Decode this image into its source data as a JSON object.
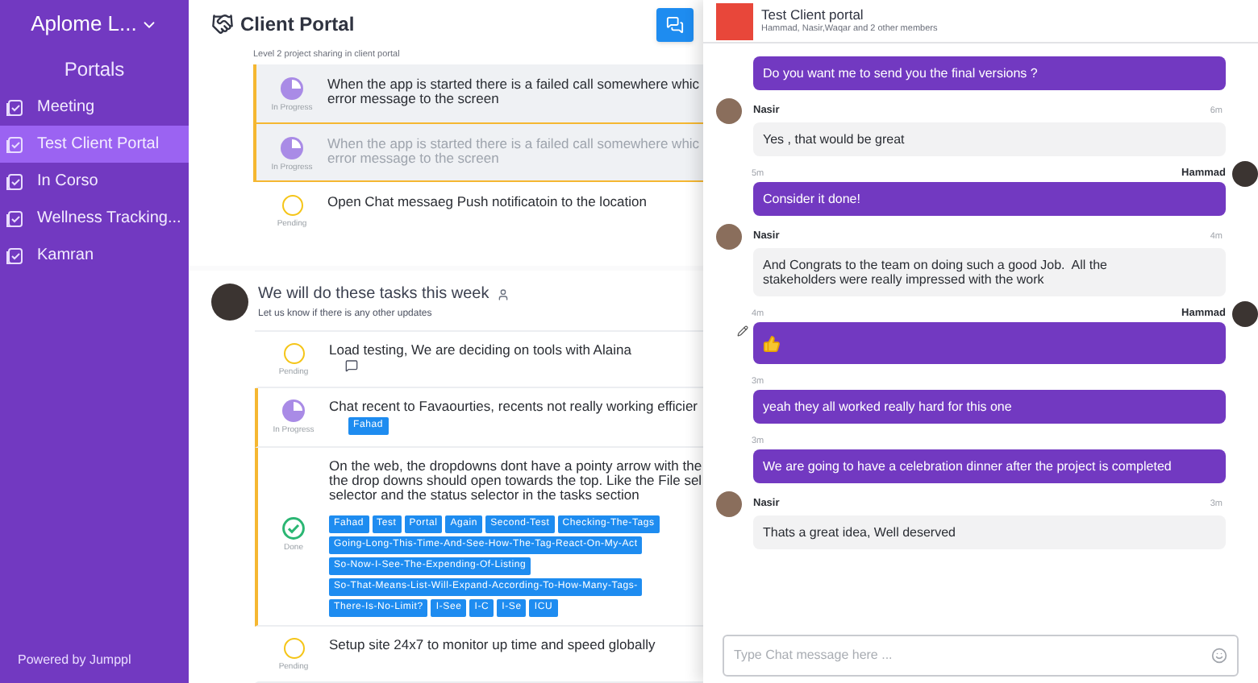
{
  "sidebar": {
    "org": "Aplome L...",
    "section": "Portals",
    "items": [
      {
        "label": "Meeting",
        "selected": false
      },
      {
        "label": "Test Client Portal",
        "selected": true
      },
      {
        "label": "In Corso",
        "selected": false
      },
      {
        "label": "Wellness Tracking...",
        "selected": false
      },
      {
        "label": "Kamran",
        "selected": false
      }
    ],
    "footer": "Powered by Jumppl"
  },
  "header": {
    "title": "Client Portal"
  },
  "main": {
    "note": "Level 2 project sharing in client portal",
    "tasks": [
      {
        "kind": "in_progress",
        "status_label": "In Progress",
        "text": "When the app is started there is a failed call somewhere whic\nerror message to the screen",
        "ghost": false,
        "selected": true
      },
      {
        "kind": "in_progress",
        "status_label": "In Progress",
        "text": "When the app is started there is a failed call somewhere whic\nerror message to the screen",
        "ghost": true,
        "selected": true
      },
      {
        "kind": "pending",
        "status_label": "Pending",
        "text": "Open Chat messaeg Push notificatoin to the location",
        "ghost": false,
        "selected": false
      }
    ],
    "post": {
      "title": "We will do these tasks this week",
      "subtitle": "Let us know if there is any other updates",
      "tasks": [
        {
          "kind": "pending",
          "status_label": "Pending",
          "text": "Load testing, We are deciding on tools with Alaina",
          "comment": true
        },
        {
          "kind": "in_progress",
          "status_label": "In Progress",
          "text": "Chat recent to Favaourties, recents not really working efficier",
          "comment": false,
          "tag_rows": [
            [
              "Fahad"
            ]
          ]
        },
        {
          "kind": "done",
          "status_label": "Done",
          "text": "On the web, the dropdowns dont have a pointy arrow with the\nthe drop downs should open towards the top. Like the File sel\nselector and the status selector in the tasks section",
          "comment": false,
          "tag_rows": [
            [
              "Fahad",
              "Test",
              "Portal",
              "Again",
              "Second-Test",
              "Checking-The-Tags"
            ],
            [
              "Going-Long-This-Time-And-See-How-The-Tag-React-On-My-Act"
            ],
            [
              "So-Now-I-See-The-Expending-Of-Listing"
            ],
            [
              "So-That-Means-List-Will-Expand-According-To-How-Many-Tags-"
            ],
            [
              "There-Is-No-Limit?",
              "I-See",
              "I-C",
              "I-Se",
              "ICU"
            ]
          ]
        },
        {
          "kind": "pending",
          "status_label": "Pending",
          "text": "Setup site 24x7 to monitor up time and speed globally",
          "comment": false
        }
      ]
    }
  },
  "chat": {
    "title": "Test Client portal",
    "members": "Hammad, Nasir,Waqar and 2 other members",
    "messages": [
      {
        "kind": "text",
        "outgoing": true,
        "text": "Do you want me to send you the final versions ?"
      },
      {
        "kind": "text",
        "outgoing": false,
        "author": "Nasir",
        "time": "6m",
        "text": "Yes , that would be great"
      },
      {
        "kind": "text",
        "outgoing": true,
        "author": "Hammad",
        "time": "5m",
        "text": "Consider it done!"
      },
      {
        "kind": "text",
        "outgoing": false,
        "author": "Nasir",
        "time": "4m",
        "text": "And Congrats to the team on doing such a good Job.  All the\nstakeholders were really impressed with the work"
      },
      {
        "kind": "thumbs_up",
        "outgoing": true,
        "author": "Hammad",
        "time": "4m",
        "edited": true
      },
      {
        "kind": "text",
        "outgoing": true,
        "time": "3m",
        "text": "yeah they all worked really hard for this one"
      },
      {
        "kind": "text",
        "outgoing": true,
        "time": "3m",
        "text": "We are going to have a celebration dinner after the project is completed"
      },
      {
        "kind": "text",
        "outgoing": false,
        "author": "Nasir",
        "time": "3m",
        "text": "Thats a great idea, Well deserved"
      }
    ],
    "placeholder": "Type Chat message here ..."
  }
}
